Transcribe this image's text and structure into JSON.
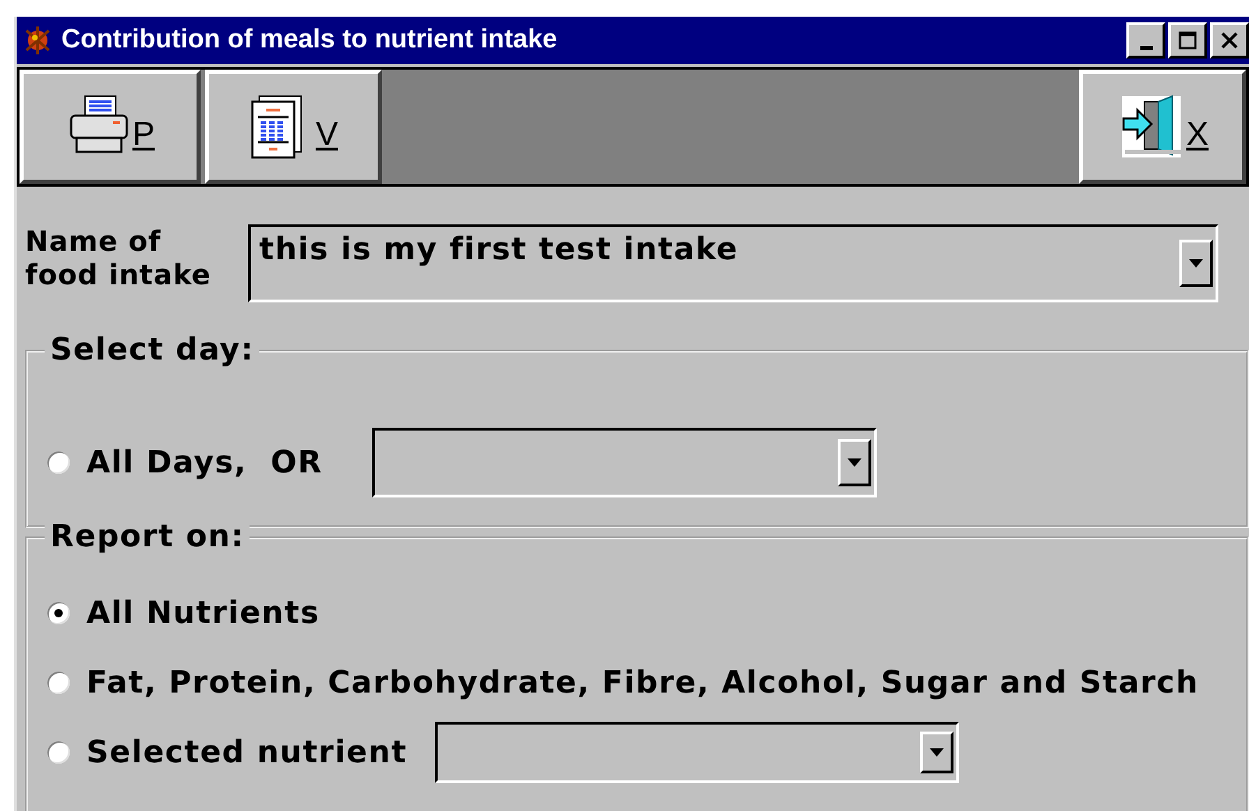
{
  "window": {
    "title": "Contribution of meals to nutrient intake"
  },
  "toolbar": {
    "buttons": [
      {
        "kind": "print",
        "label": "P"
      },
      {
        "kind": "view",
        "label": "V"
      },
      {
        "kind": "exit",
        "label": "X"
      }
    ]
  },
  "intake": {
    "label": "Name of\nfood intake",
    "value": "this is my first test intake"
  },
  "select_day": {
    "title": "Select day:",
    "options": [
      {
        "label": "All Days,  OR",
        "selected": false
      }
    ]
  },
  "report_on": {
    "title": "Report on:",
    "options": [
      {
        "label": "All Nutrients",
        "selected": true,
        "kind": "plain"
      },
      {
        "label": "Fat, Protein, Carbohydrate, Fibre, Alcohol, Sugar and Starch",
        "selected": false,
        "kind": "plain"
      },
      {
        "label": "Selected nutrient",
        "selected": false,
        "kind": "with_dropdown"
      }
    ]
  }
}
